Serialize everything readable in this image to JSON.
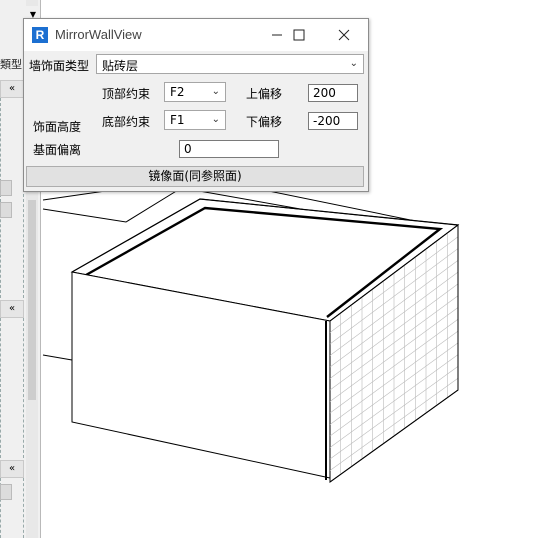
{
  "panel": {
    "label": "類型",
    "collapse_glyph": "«"
  },
  "dialog": {
    "title": "MirrorWallView",
    "logo_letter": "R",
    "icons": [
      "revit-logo-icon",
      "minimize-icon",
      "maximize-icon",
      "close-icon"
    ],
    "face_type_label": "墙饰面类型",
    "face_type_value": "贴砖层",
    "face_height_label": "饰面高度",
    "top_constraint_label": "顶部约束",
    "top_constraint_value": "F2",
    "top_offset_label": "上偏移",
    "top_offset_value": "200",
    "bottom_constraint_label": "底部约束",
    "bottom_constraint_value": "F1",
    "bottom_offset_label": "下偏移",
    "bottom_offset_value": "-200",
    "base_offset_label": "基面偏离",
    "base_offset_value": "0",
    "mirror_button_label": "镜像面(同参照面)"
  },
  "colors": {
    "dialog_bg": "#f0f0f0",
    "logo": "#1c6fd1",
    "tile_grid": "#bbbbbb"
  }
}
